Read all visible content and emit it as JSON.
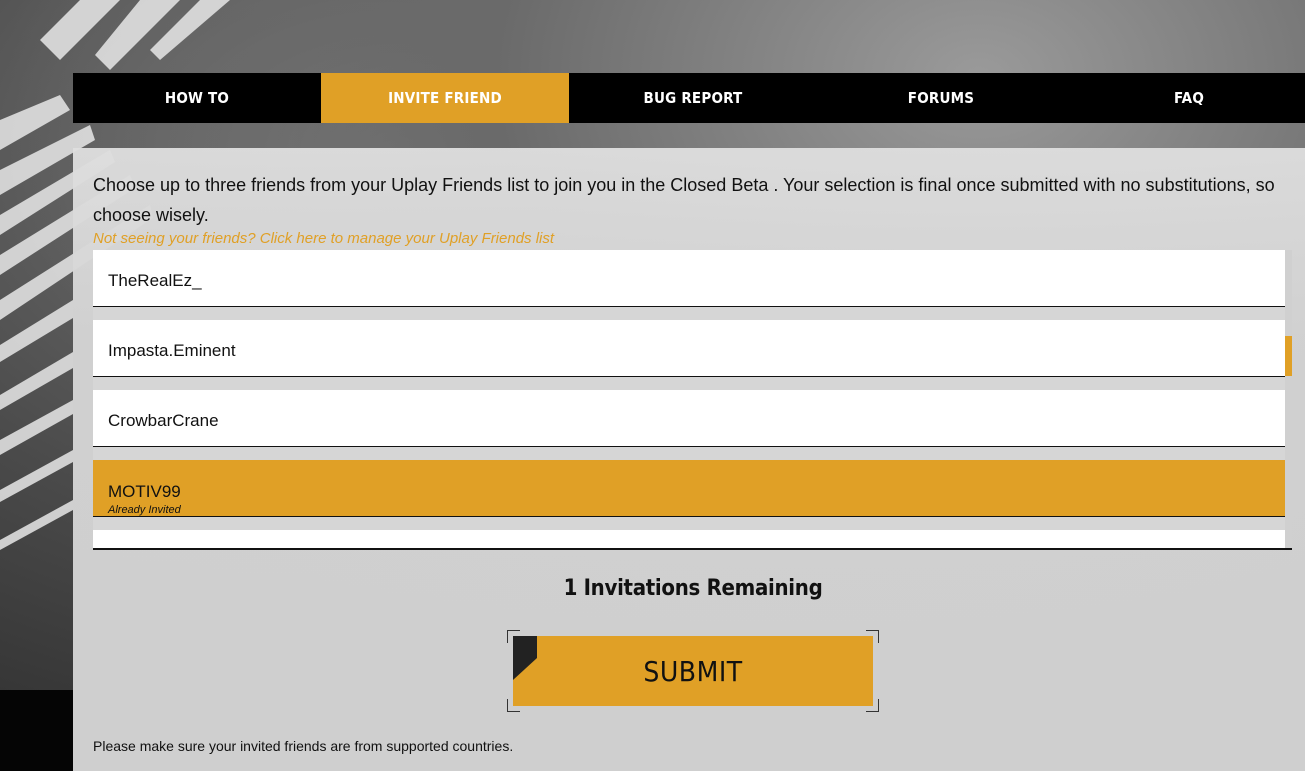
{
  "nav": {
    "items": [
      {
        "label": "HOW TO"
      },
      {
        "label": "INVITE FRIEND"
      },
      {
        "label": "BUG REPORT"
      },
      {
        "label": "FORUMS"
      },
      {
        "label": "FAQ"
      }
    ],
    "active_index": 1
  },
  "invite": {
    "intro": "Choose up to three friends from your Uplay Friends list to join you in the Closed Beta . Your selection is final once submitted with no substitutions, so choose wisely.",
    "manage_link": "Not seeing your friends? Click here to manage your Uplay Friends list",
    "friends": [
      {
        "name": "TheRealEz_",
        "status": ""
      },
      {
        "name": "Impasta.Eminent",
        "status": ""
      },
      {
        "name": "CrowbarCrane",
        "status": ""
      },
      {
        "name": "MOTIV99",
        "status": "Already Invited"
      },
      {
        "name": "",
        "status": ""
      }
    ],
    "remaining_text": "1 Invitations Remaining",
    "submit_label": "SUBMIT",
    "footnote": "Please make sure your invited friends are from supported countries."
  },
  "colors": {
    "accent": "#e0a026",
    "nav_bg": "#000000",
    "panel_bg": "#d4d4d4"
  }
}
